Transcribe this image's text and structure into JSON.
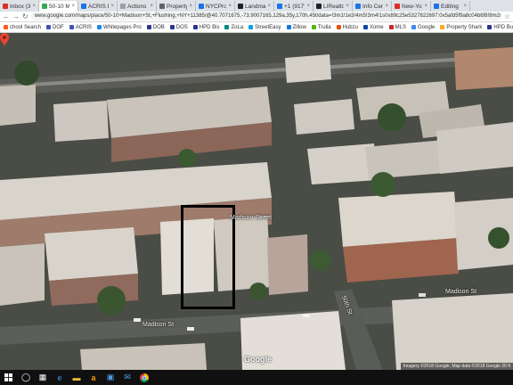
{
  "browser": {
    "tabs": [
      {
        "label": "Inbox (3)",
        "favicon_color": "#d93025"
      },
      {
        "label": "50-10 M...",
        "favicon_color": "#34a853",
        "active": true
      },
      {
        "label": "ACRIS Do",
        "favicon_color": "#1a73e8"
      },
      {
        "label": "Actions",
        "favicon_color": "#9aa0a6"
      },
      {
        "label": "Property",
        "favicon_color": "#5f6368"
      },
      {
        "label": "NYCProp",
        "favicon_color": "#1a73e8"
      },
      {
        "label": "Landmar",
        "favicon_color": "#202124"
      },
      {
        "label": "+1 (917)",
        "favicon_color": "#1a73e8"
      },
      {
        "label": "LIRealtor",
        "favicon_color": "#202124"
      },
      {
        "label": "Info Centr",
        "favicon_color": "#1a73e8"
      },
      {
        "label": "New-York",
        "favicon_color": "#d93025"
      },
      {
        "label": "Editing",
        "favicon_color": "#1a73e8"
      }
    ],
    "url": "www.google.com/maps/place/50-10+Madison+St,+Flushing,+NY+11385/@40.7071675,-73.9007165,129a,35y,170h,45t/data=!3m1!1e3!4m5!3m4!1s0x89c25e5327822697:0x5afd5f9a8c04b6f8!8m2!3d40.7062153!4d-73.8997987?hl=en&authuser=0",
    "bookmarks": [
      {
        "label": "chool Search",
        "favicon_color": "#ff5722"
      },
      {
        "label": "DOF",
        "favicon_color": "#3f51b5"
      },
      {
        "label": "ACRIS",
        "favicon_color": "#3f51b5"
      },
      {
        "label": "Whitepages Pro",
        "favicon_color": "#1e88e5"
      },
      {
        "label": "DOB",
        "favicon_color": "#283593"
      },
      {
        "label": "DOS",
        "favicon_color": "#283593"
      },
      {
        "label": "HPD Bis",
        "favicon_color": "#283593"
      },
      {
        "label": "ZoLa",
        "favicon_color": "#00897b"
      },
      {
        "label": "StreetEasy",
        "favicon_color": "#00a1e4"
      },
      {
        "label": "Zillow",
        "favicon_color": "#1277e1"
      },
      {
        "label": "Trulia",
        "favicon_color": "#53b50a"
      },
      {
        "label": "Hubzu",
        "favicon_color": "#e65100"
      },
      {
        "label": "Xome",
        "favicon_color": "#0d47a1"
      },
      {
        "label": "MLS",
        "favicon_color": "#c62828"
      },
      {
        "label": "Google",
        "favicon_color": "#4285f4"
      },
      {
        "label": "Property Shark",
        "favicon_color": "#f9a825"
      },
      {
        "label": "HPD Building Info",
        "favicon_color": "#283593"
      }
    ]
  },
  "map": {
    "street_labels": {
      "madison_street_top": "Madison Street",
      "madison_st_right": "Madison St",
      "madison_st_bottom": "Madison St",
      "cross_street": "50th St"
    },
    "google_logo": "Google",
    "attribution": "Imagery ©2018 Google, Map data ©2018 Google   20 ft"
  },
  "taskbar": {
    "icons": [
      "windows-start",
      "cortana",
      "task-view",
      "edge",
      "explorer",
      "amazon",
      "store",
      "mail",
      "chrome"
    ],
    "time": "",
    "date": ""
  },
  "colors": {
    "tab_bg": "#dee1e6",
    "highlight_border": "#000000",
    "pin": "#ea4335",
    "taskbar": "#101010"
  }
}
